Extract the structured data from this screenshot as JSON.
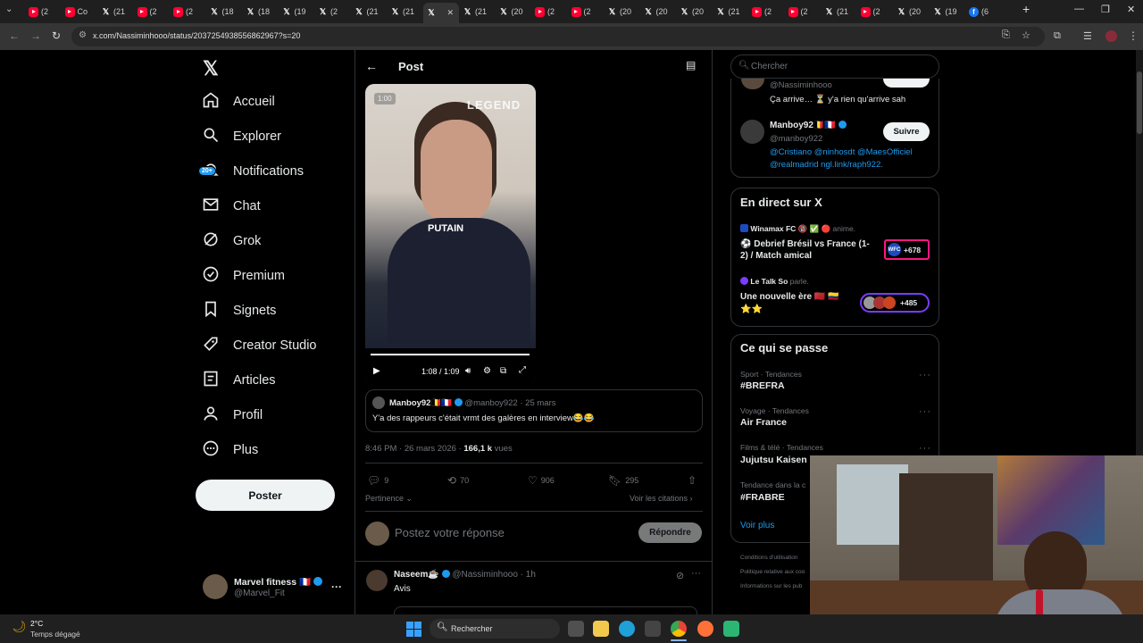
{
  "browser": {
    "tab_labels": [
      "(2",
      "Co",
      "(21",
      "(2",
      "(2",
      "(18",
      "(18",
      "(19",
      "(2",
      "(21",
      "(21",
      "",
      "(21",
      "(20",
      "(2",
      "(2",
      "(20",
      "(20",
      "(20",
      "(21",
      "(2",
      "(2",
      "(21",
      "(2",
      "(20",
      "(19",
      "(6"
    ],
    "url": "x.com/Nassiminhooo/status/2037254938556862967?s=20"
  },
  "nav": {
    "items": [
      {
        "label": "Accueil",
        "icon": "home-icon"
      },
      {
        "label": "Explorer",
        "icon": "search-icon"
      },
      {
        "label": "Notifications",
        "icon": "bell-icon"
      },
      {
        "label": "Chat",
        "icon": "mail-icon"
      },
      {
        "label": "Grok",
        "icon": "grok-icon"
      },
      {
        "label": "Premium",
        "icon": "verified-icon"
      },
      {
        "label": "Signets",
        "icon": "bookmark-icon"
      },
      {
        "label": "Creator Studio",
        "icon": "rocket-icon"
      },
      {
        "label": "Articles",
        "icon": "article-icon"
      },
      {
        "label": "Profil",
        "icon": "person-icon"
      },
      {
        "label": "Plus",
        "icon": "more-circle-icon"
      }
    ],
    "notif_badge": "20+",
    "post_button": "Poster",
    "account_name": "Marvel fitness",
    "account_flag": "🇫🇷",
    "account_handle": "@Marvel_Fit"
  },
  "post": {
    "header": "Post",
    "video": {
      "overlay_small": "1:00",
      "watermark": "LEGEND",
      "caption": "PUTAIN",
      "time": "1:08 / 1:09"
    },
    "quote": {
      "author": "Manboy92",
      "author_flags": "🇧🇪🇫🇷",
      "handle": "@manboy922",
      "date": "· 25 mars",
      "text": "Y'a des rappeurs c'était vrmt des galères en interview",
      "emojis": "😂😂"
    },
    "timestamp": "8:46 PM · 26 mars 2026 · ",
    "views_count": "166,1 k",
    "views_label": " vues",
    "replies": "9",
    "reposts": "70",
    "likes": "906",
    "bookmarks": "295",
    "sort_label": "Pertinence",
    "quotes_link": "Voir les citations",
    "reply_placeholder": "Postez votre réponse",
    "reply_button": "Répondre"
  },
  "reply_tweet": {
    "author": "Naseem",
    "author_emoji": "☕",
    "handle": "@Nassiminhooo",
    "time": "· 1h",
    "text": "Avis"
  },
  "sidebar": {
    "search_placeholder": "Chercher",
    "top_card": {
      "handle1": "@Nassiminhooo",
      "text1": "Ça arrive… ⏳ y'a rien qu'arrive sah",
      "name2": "Manboy92",
      "flags2": "🇧🇪🇫🇷",
      "handle2": "@manboy922",
      "follow": "Suivre",
      "bio_line1": "@Cristiano @ninhosdt @MaesOfficiel",
      "bio_line2": "@realmadrid ngl.link/raph922."
    },
    "live": {
      "title": "En direct sur X",
      "items": [
        {
          "host": "Winamax FC",
          "host_extra": "🔞 ✅ 🔴 anime.",
          "title": "⚽ Debrief Brésil vs France (1-2) / Match amical",
          "count": "+678",
          "logo": "WFC"
        },
        {
          "host": "Le Talk So",
          "host_extra": "parle.",
          "title": "Une nouvelle ère 🇲🇦 🇨🇴",
          "title2": "⭐⭐",
          "count": "+485"
        }
      ]
    },
    "trends": {
      "title": "Ce qui se passe",
      "items": [
        {
          "category": "Sport · Tendances",
          "name": "#BREFRA"
        },
        {
          "category": "Voyage · Tendances",
          "name": "Air France"
        },
        {
          "category": "Films & télé · Tendances",
          "name": "Jujutsu Kaisen"
        },
        {
          "category": "Tendance dans la c",
          "name": "#FRABRE"
        }
      ],
      "show_more": "Voir plus"
    },
    "footer": [
      "Conditions d'utilisation",
      "Politique relative aux coo",
      "Informations sur les pub"
    ]
  },
  "taskbar": {
    "weather_temp": "2°C",
    "weather_desc": "Temps dégagé",
    "search": "Rechercher"
  },
  "colors": {
    "accent": "#1d9bf0",
    "background": "#000000",
    "border": "#2f3336",
    "muted": "#71767b",
    "live_red": "#f91880"
  }
}
